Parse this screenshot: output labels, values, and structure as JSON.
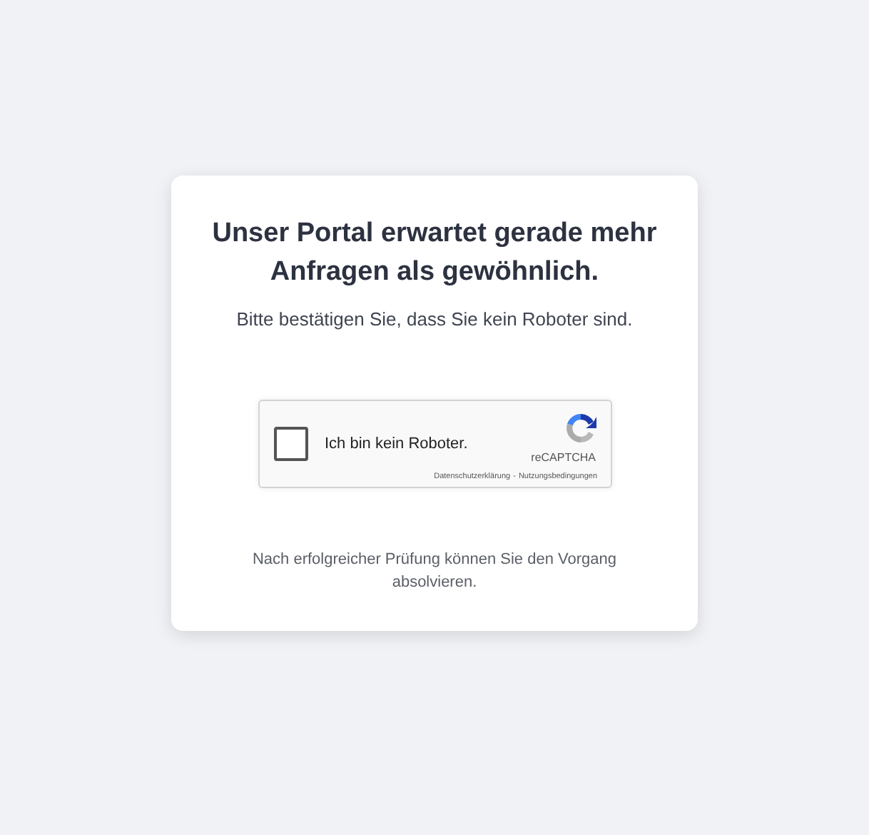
{
  "card": {
    "title": "Unser Portal erwartet gerade mehr Anfragen als gewöhnlich.",
    "subtitle": "Bitte bestätigen Sie, dass Sie kein Roboter sind.",
    "captcha": {
      "label": "Ich bin kein Roboter.",
      "checked": false,
      "brand": "reCAPTCHA",
      "privacy_link": "Datenschutzerklärung",
      "separator": "-",
      "terms_link": "Nutzungsbedingungen"
    },
    "note": "Nach erfolgreicher Prüfung können Sie den Vorgang absolvieren."
  }
}
